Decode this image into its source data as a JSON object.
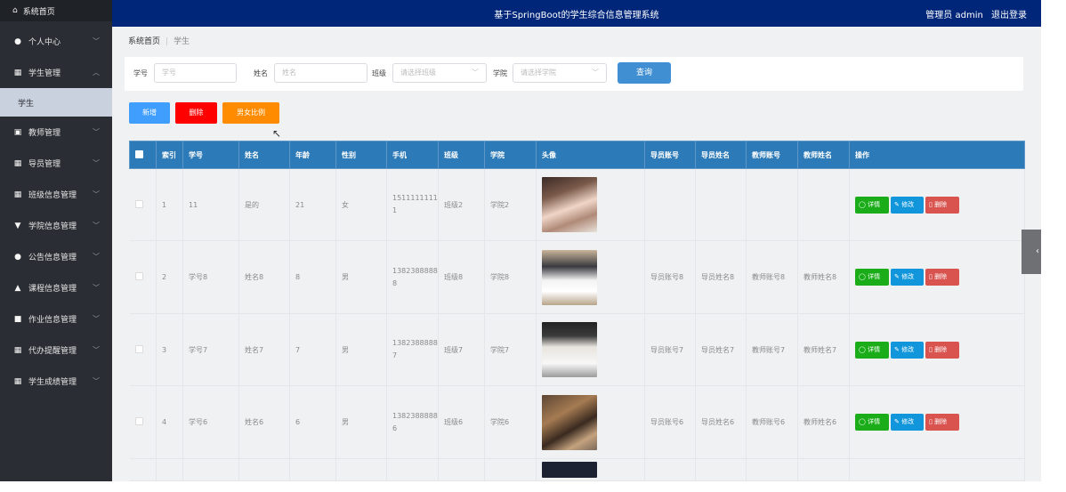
{
  "sidebar": {
    "home": {
      "label": "系统首页",
      "icon": "home-icon"
    },
    "items": [
      {
        "label": "个人中心",
        "icon": "person-icon",
        "expanded": false
      },
      {
        "label": "学生管理",
        "icon": "grid-icon",
        "expanded": true,
        "children": [
          {
            "label": "学生"
          }
        ]
      },
      {
        "label": "教师管理",
        "icon": "clipboard-icon",
        "expanded": false
      },
      {
        "label": "导员管理",
        "icon": "grid-icon",
        "expanded": false
      },
      {
        "label": "班级信息管理",
        "icon": "grid-icon",
        "expanded": false
      },
      {
        "label": "学院信息管理",
        "icon": "pin-icon",
        "expanded": false
      },
      {
        "label": "公告信息管理",
        "icon": "person-icon",
        "expanded": false
      },
      {
        "label": "课程信息管理",
        "icon": "thumb-icon",
        "expanded": false
      },
      {
        "label": "作业信息管理",
        "icon": "chat-icon",
        "expanded": false
      },
      {
        "label": "代办提醒管理",
        "icon": "grid-icon",
        "expanded": false
      },
      {
        "label": "学生成绩管理",
        "icon": "grid-icon",
        "expanded": false
      }
    ]
  },
  "header": {
    "title": "基于SpringBoot的学生综合信息管理系统",
    "user": "管理员 admin",
    "logout": "退出登录"
  },
  "breadcrumb": {
    "home": "系统首页",
    "current": "学生"
  },
  "search": {
    "xuehao_label": "学号",
    "xuehao_placeholder": "学号",
    "xingming_label": "姓名",
    "xingming_placeholder": "姓名",
    "banji_label": "班级",
    "banji_placeholder": "请选择班级",
    "xueyuan_label": "学院",
    "xueyuan_placeholder": "请选择学院",
    "query_label": "查询"
  },
  "actions": {
    "add": "新增",
    "delete": "删除",
    "ratio": "男女比例"
  },
  "colors": {
    "sidebar": "#2a2d33",
    "header": "#00267a",
    "table_header": "#2d7ab8",
    "add": "#409eff",
    "delete": "#ff0000",
    "ratio": "#ff8c00"
  },
  "table": {
    "headers": [
      "索引",
      "学号",
      "姓名",
      "年龄",
      "性别",
      "手机",
      "班级",
      "学院",
      "头像",
      "导员账号",
      "导员姓名",
      "教师账号",
      "教师姓名",
      "操作"
    ],
    "rows": [
      {
        "index": "1",
        "xuehao": "11",
        "xingming": "是的",
        "age": "21",
        "sex": "女",
        "phone": "15111111111",
        "banji": "班级2",
        "xueyuan": "学院2",
        "daoyuan_account": "",
        "daoyuan_name": "",
        "teacher_account": "",
        "teacher_name": ""
      },
      {
        "index": "2",
        "xuehao": "学号8",
        "xingming": "姓名8",
        "age": "8",
        "sex": "男",
        "phone": "13823888888",
        "banji": "班级8",
        "xueyuan": "学院8",
        "daoyuan_account": "导员账号8",
        "daoyuan_name": "导员姓名8",
        "teacher_account": "教师账号8",
        "teacher_name": "教师姓名8"
      },
      {
        "index": "3",
        "xuehao": "学号7",
        "xingming": "姓名7",
        "age": "7",
        "sex": "男",
        "phone": "13823888887",
        "banji": "班级7",
        "xueyuan": "学院7",
        "daoyuan_account": "导员账号7",
        "daoyuan_name": "导员姓名7",
        "teacher_account": "教师账号7",
        "teacher_name": "教师姓名7"
      },
      {
        "index": "4",
        "xuehao": "学号6",
        "xingming": "姓名6",
        "age": "6",
        "sex": "男",
        "phone": "13823888886",
        "banji": "班级6",
        "xueyuan": "学院6",
        "daoyuan_account": "导员账号6",
        "daoyuan_name": "导员姓名6",
        "teacher_account": "教师账号6",
        "teacher_name": "教师姓名6"
      }
    ],
    "row_buttons": {
      "detail": "详情",
      "edit": "修改",
      "delete": "删除"
    }
  }
}
